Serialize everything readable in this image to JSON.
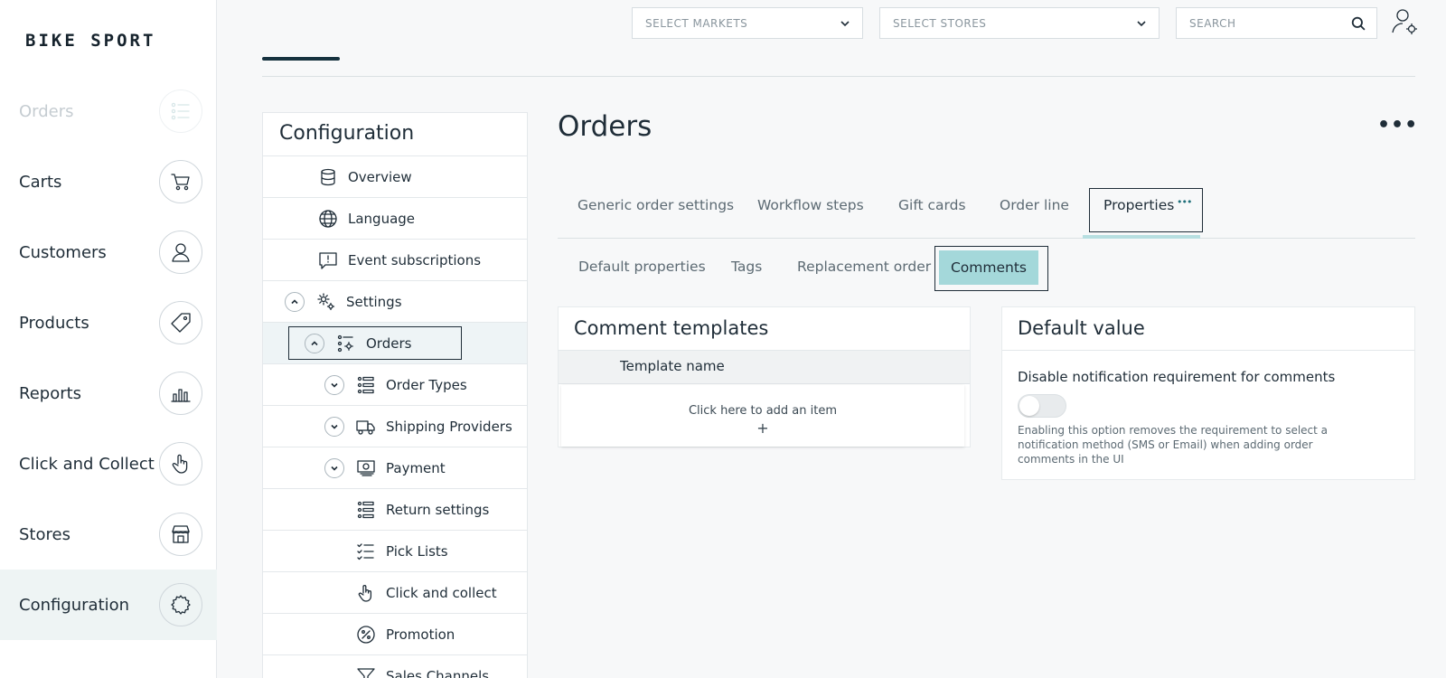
{
  "brand": {
    "logo_text": "BIKE SPORT"
  },
  "sidebar": {
    "items": [
      {
        "label": "Orders",
        "icon": "orders-list-icon",
        "state": "faded"
      },
      {
        "label": "Carts",
        "icon": "cart-icon"
      },
      {
        "label": "Customers",
        "icon": "customer-icon"
      },
      {
        "label": "Products",
        "icon": "tag-icon"
      },
      {
        "label": "Reports",
        "icon": "bar-chart-icon"
      },
      {
        "label": "Click and Collect",
        "icon": "hand-pointer-icon"
      },
      {
        "label": "Stores",
        "icon": "store-icon"
      },
      {
        "label": "Configuration",
        "icon": "gear-icon",
        "state": "active"
      }
    ]
  },
  "topbar": {
    "markets_placeholder": "SELECT MARKETS",
    "stores_placeholder": "SELECT STORES",
    "search_placeholder": "SEARCH"
  },
  "config_panel": {
    "title": "Configuration",
    "items": [
      {
        "label": "Overview",
        "icon": "database-icon"
      },
      {
        "label": "Language",
        "icon": "globe-icon"
      },
      {
        "label": "Event subscriptions",
        "icon": "message-icon"
      },
      {
        "label": "Settings",
        "icon": "settings-gears-icon",
        "expanded": true
      },
      {
        "label": "Orders",
        "icon": "orders-settings-icon",
        "expanded": true,
        "selected": true
      },
      {
        "label": "Order Types",
        "icon": "list-icon",
        "collapsed": true
      },
      {
        "label": "Shipping Providers",
        "icon": "truck-icon",
        "collapsed": true
      },
      {
        "label": "Payment",
        "icon": "payment-icon",
        "collapsed": true
      },
      {
        "label": "Return settings",
        "icon": "list-icon"
      },
      {
        "label": "Pick Lists",
        "icon": "checklist-icon"
      },
      {
        "label": "Click and collect",
        "icon": "hand-pointer-icon"
      },
      {
        "label": "Promotion",
        "icon": "percent-icon"
      },
      {
        "label": "Sales Channels",
        "icon": "funnel-icon"
      }
    ]
  },
  "main": {
    "title": "Orders",
    "more_label": "•••",
    "tabs": [
      {
        "label": "Generic order settings"
      },
      {
        "label": "Workflow steps"
      },
      {
        "label": "Gift cards"
      },
      {
        "label": "Order line"
      },
      {
        "label": "Properties",
        "active": true
      }
    ],
    "active_tab_dots": "•••",
    "subtabs": [
      {
        "label": "Default properties"
      },
      {
        "label": "Tags"
      },
      {
        "label": "Replacement order"
      },
      {
        "label": "Comments",
        "active": true
      }
    ],
    "comment_templates": {
      "title": "Comment templates",
      "column_header": "Template name",
      "add_item_text": "Click here to add an item",
      "add_symbol": "+"
    },
    "default_value": {
      "title": "Default value",
      "setting_label": "Disable notification requirement for comments",
      "toggle_on": false,
      "help_text": "Enabling this option removes the requirement to select a notification method (SMS or Email) when adding order comments in the UI"
    }
  },
  "colors": {
    "accent_tab_fill": "#a4d8da",
    "accent_underline": "#b7dfe1",
    "sidebar_active_bg": "#eef4f4",
    "text_dark": "#1f2d38"
  }
}
